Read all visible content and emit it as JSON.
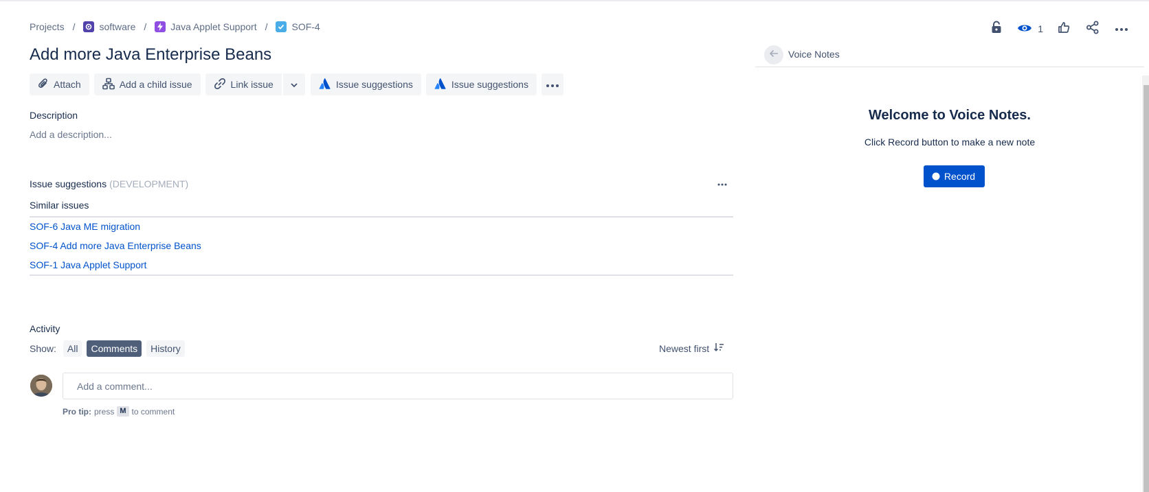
{
  "breadcrumb": {
    "projects": "Projects",
    "project": "software",
    "epic": "Java Applet Support",
    "issue_key": "SOF-4",
    "separator": "/"
  },
  "header": {
    "watch_count": "1"
  },
  "issue": {
    "title": "Add more Java Enterprise Beans"
  },
  "toolbar": {
    "attach": "Attach",
    "add_child": "Add a child issue",
    "link_issue": "Link issue",
    "suggestions_1": "Issue suggestions",
    "suggestions_2": "Issue suggestions"
  },
  "description": {
    "label": "Description",
    "placeholder": "Add a description..."
  },
  "suggestions_panel": {
    "title": "Issue suggestions",
    "tag": "(DEVELOPMENT)",
    "similar_label": "Similar issues",
    "items": [
      "SOF-6 Java ME migration",
      "SOF-4 Add more Java Enterprise Beans",
      "SOF-1 Java Applet Support"
    ]
  },
  "activity": {
    "label": "Activity",
    "show_label": "Show:",
    "filters": [
      "All",
      "Comments",
      "History"
    ],
    "active_filter": "Comments",
    "sort_label": "Newest first",
    "comment_placeholder": "Add a comment...",
    "protip_label": "Pro tip:",
    "protip_press": "press",
    "protip_key": "M",
    "protip_suffix": "to comment"
  },
  "voice_notes": {
    "title": "Voice Notes",
    "welcome": "Welcome to Voice Notes.",
    "subtitle": "Click Record button to make a new note",
    "record_button": "Record"
  },
  "colors": {
    "link": "#0052cc",
    "primary_button": "#0052cc",
    "active_filter": "#505f79",
    "epic_icon": "#904ee2",
    "task_icon": "#4bade8",
    "project_icon": "#5243aa"
  },
  "icons": {
    "project": "project-icon",
    "epic": "lightning-icon",
    "task": "checkbox-icon",
    "lock": "lock-icon",
    "watch": "eye-icon",
    "like": "thumbs-up-icon",
    "share": "share-icon",
    "more": "more-icon",
    "attach": "paperclip-icon",
    "child": "hierarchy-icon",
    "link": "link-icon",
    "atlassian": "atlassian-icon",
    "sort": "sort-icon",
    "back": "arrow-left-icon"
  }
}
